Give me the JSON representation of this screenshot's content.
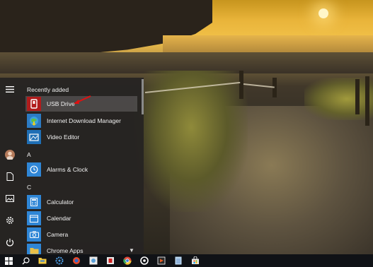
{
  "start_menu": {
    "recently_added_heading": "Recently added",
    "recent_apps": [
      {
        "label": "USB Drive",
        "icon": "usb-drive-icon",
        "color": "#b01c1c"
      },
      {
        "label": "Internet Download Manager",
        "icon": "idm-globe-icon",
        "color": "#2c7bc4"
      },
      {
        "label": "Video Editor",
        "icon": "video-editor-icon",
        "color": "#1f6fb5"
      }
    ],
    "sections": [
      {
        "letter": "A",
        "apps": [
          {
            "label": "Alarms & Clock",
            "icon": "clock-icon",
            "color": "#2f86d6"
          }
        ]
      },
      {
        "letter": "C",
        "apps": [
          {
            "label": "Calculator",
            "icon": "calculator-icon",
            "color": "#2f86d6"
          },
          {
            "label": "Calendar",
            "icon": "calendar-icon",
            "color": "#2f86d6"
          },
          {
            "label": "Camera",
            "icon": "camera-icon",
            "color": "#2f86d6"
          },
          {
            "label": "Chrome Apps",
            "icon": "folder-icon",
            "color": "#e8c048"
          }
        ]
      }
    ],
    "rail": [
      "hamburger-menu-icon",
      "user-avatar",
      "document-icon",
      "pictures-icon",
      "settings-gear-icon",
      "power-icon"
    ]
  },
  "taskbar": {
    "items": [
      "windows-start-icon",
      "search-icon",
      "file-explorer-icon",
      "gear-app-icon",
      "app-icon",
      "photo-app-icon",
      "red-app-icon",
      "chrome-icon",
      "circle-app-icon",
      "media-icon",
      "notepad-icon",
      "store-icon"
    ],
    "background": "#101216"
  },
  "colors": {
    "accent": "#2f86d6",
    "annotation_arrow": "#e01010"
  }
}
